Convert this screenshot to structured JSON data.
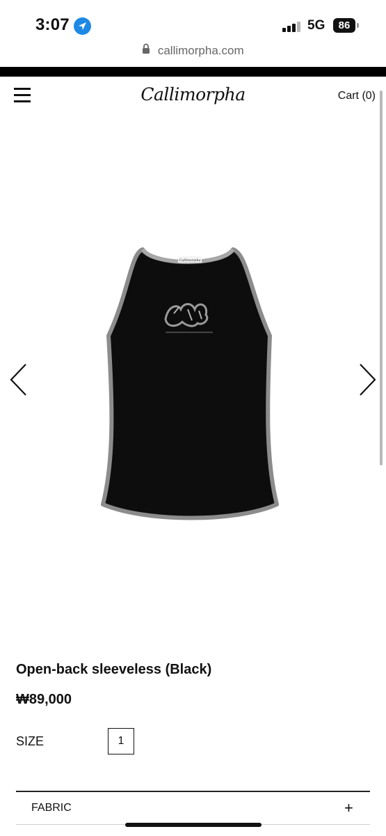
{
  "status_bar": {
    "time": "3:07",
    "network": "5G",
    "battery": "86"
  },
  "browser": {
    "url": "callimorpha.com"
  },
  "header": {
    "brand": "Callimorpha",
    "cart": "Cart (0)"
  },
  "product": {
    "title": "Open-back sleeveless (Black)",
    "price": "₩89,000",
    "size_label": "SIZE",
    "size_options": [
      "1"
    ],
    "garment_label": "Callimorpha"
  },
  "accordion": {
    "fabric_label": "FABRIC",
    "expand_symbol": "+"
  },
  "colors": {
    "text": "#111111",
    "accent_blue": "#1e88e5",
    "garment": "#0d0d0d",
    "trim": "#8c8c8c"
  }
}
